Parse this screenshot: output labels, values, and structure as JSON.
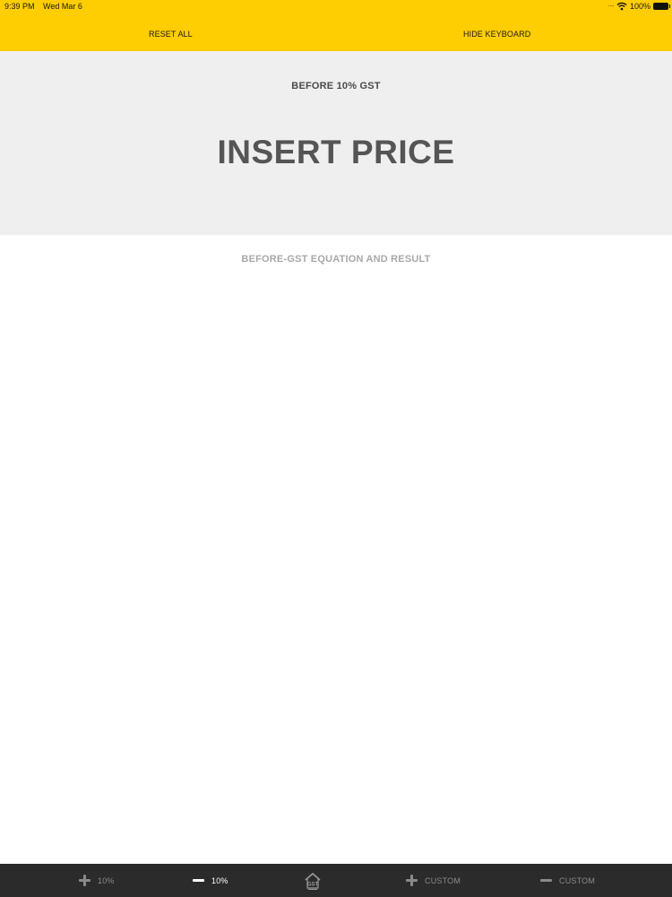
{
  "status_bar": {
    "time": "9:39 PM",
    "date": "Wed Mar 6",
    "battery": "100%"
  },
  "header": {
    "reset_label": "RESET ALL",
    "hide_keyboard_label": "HIDE KEYBOARD"
  },
  "price_panel": {
    "label": "BEFORE 10% GST",
    "input_placeholder": "INSERT PRICE",
    "input_value": ""
  },
  "result": {
    "label": "BEFORE-GST EQUATION AND RESULT"
  },
  "tab_bar": {
    "tabs": [
      {
        "label": "10%",
        "icon": "plus-icon",
        "active": false
      },
      {
        "label": "10%",
        "icon": "minus-icon",
        "active": true
      },
      {
        "label": "GST",
        "icon": "gst-house-icon",
        "active": false
      },
      {
        "label": "CUSTOM",
        "icon": "plus-icon",
        "active": false
      },
      {
        "label": "CUSTOM",
        "icon": "minus-icon",
        "active": false
      }
    ]
  },
  "colors": {
    "header_bg": "#fecd02",
    "panel_bg": "#efeff0",
    "tab_bar_bg": "#2b2b2b"
  }
}
